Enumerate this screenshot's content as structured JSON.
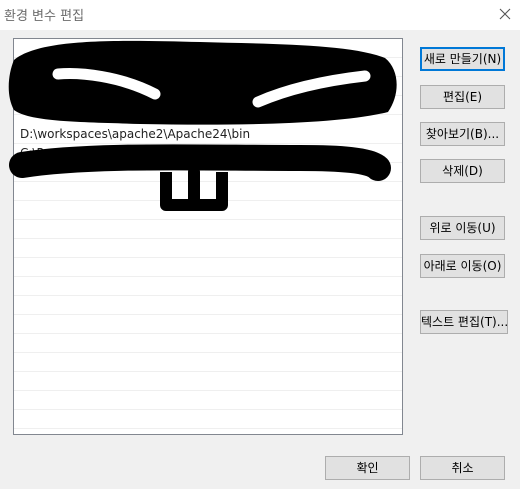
{
  "window": {
    "title": "환경 변수 편집",
    "close_icon": "close-icon"
  },
  "list": {
    "rows": [
      "",
      "",
      "",
      "",
      "D:\\workspaces\\apache2\\Apache24\\bin",
      "C:\\Progra",
      "",
      "",
      "",
      "",
      "",
      "",
      "",
      "",
      "",
      "",
      "",
      "",
      "",
      "",
      ""
    ]
  },
  "buttons": {
    "new": "새로 만들기(N)",
    "edit": "편집(E)",
    "browse": "찾아보기(B)...",
    "delete": "삭제(D)",
    "move_up": "위로 이동(U)",
    "move_down": "아래로 이동(O)",
    "edit_text": "텍스트 편집(T)...",
    "ok": "확인",
    "cancel": "취소"
  },
  "colors": {
    "background": "#f0f0f0",
    "list_background": "#ffffff",
    "button_face": "#e1e1e1",
    "button_border": "#adadad",
    "focus_border": "#0078d7",
    "redaction": "#000000"
  }
}
